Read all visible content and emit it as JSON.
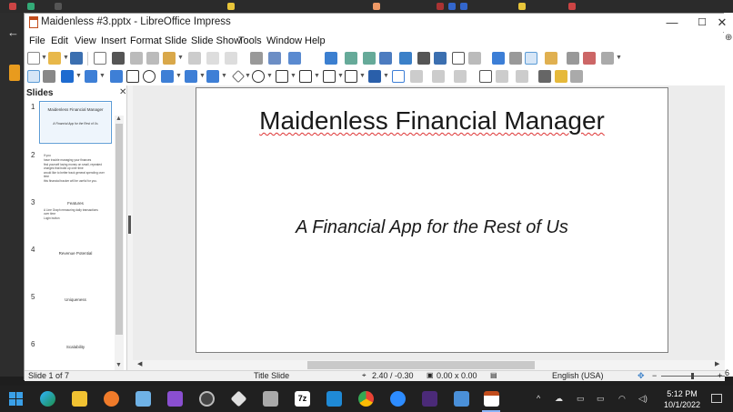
{
  "window": {
    "title": "Maidenless #3.pptx - LibreOffice Impress",
    "minimize": "—",
    "maximize": "☐",
    "close": "✕"
  },
  "menu": [
    "File",
    "Edit",
    "View",
    "Insert",
    "Format",
    "Slide",
    "Slide Show",
    "Tools",
    "Window",
    "Help"
  ],
  "slides_panel": {
    "title": "Slides",
    "close": "✕",
    "thumbnails": [
      {
        "num": "1",
        "title": "Maidenless Financial Manager",
        "subtitle": "A Financial App for the Rest of Us"
      },
      {
        "num": "2",
        "bullets": [
          "If you",
          "have trouble managing your finances",
          "find yourself losing money on small, repeated",
          "charges that build up over time",
          "would like to better track general spending over",
          "time",
          "this financial tracker will be useful for you."
        ]
      },
      {
        "num": "3",
        "title": "Features",
        "bullets": [
          "A Line Graph measuring daily transactions",
          "over time",
          "Login button"
        ]
      },
      {
        "num": "4",
        "title": "Revenue Potential"
      },
      {
        "num": "5",
        "title": "Uniqueness"
      },
      {
        "num": "6",
        "title": "Scalability"
      }
    ]
  },
  "slide": {
    "title": "Maidenless Financial Manager",
    "subtitle": "A Financial App for the Rest of Us"
  },
  "status": {
    "slide_of": "Slide 1 of 7",
    "layout": "Title Slide",
    "position": "2.40 / -0.30",
    "size": "0.00 x 0.00",
    "language": "English (USA)",
    "zoom_minus": "−",
    "zoom_plus": "+",
    "zoom_tail": "6"
  },
  "taskbar": {
    "time": "5:12 PM",
    "date": "10/1/2022",
    "tray_up": "^",
    "ext_7z": "7z"
  },
  "colors": {
    "selection": "#5b9bd5",
    "spellcheck": "#d33",
    "impress_orange": "#c24d1c"
  }
}
